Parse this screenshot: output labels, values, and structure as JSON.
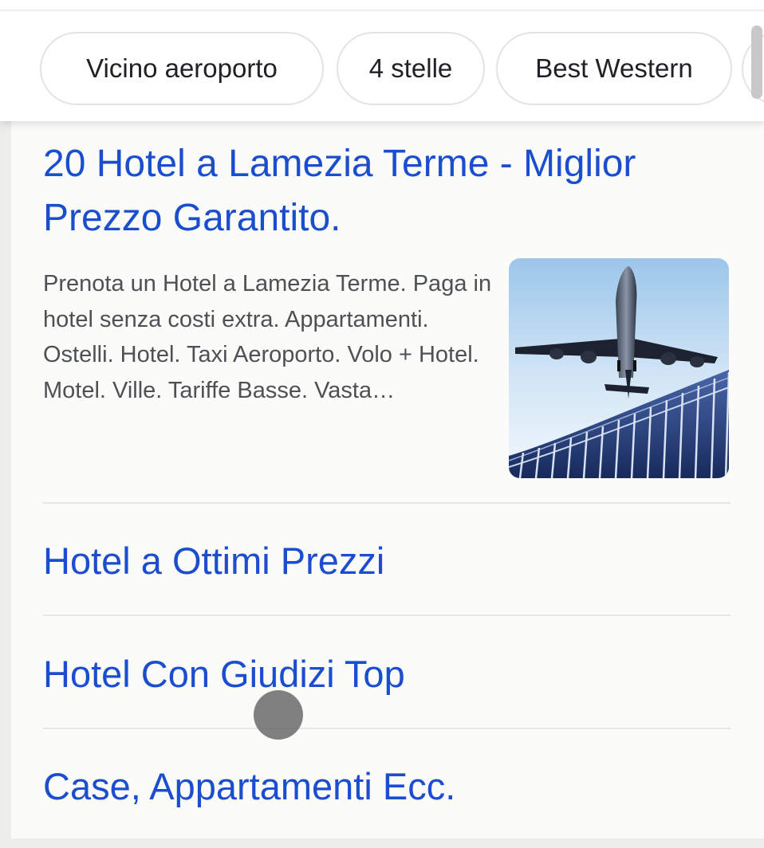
{
  "filter_chips": [
    "Vicino aeroporto",
    "4 stelle",
    "Best Western"
  ],
  "result": {
    "title": "20 Hotel a Lamezia Terme - Miglior Prezzo Garantito.",
    "description": "Prenota un Hotel a Lamezia Terme. Paga in hotel senza costi extra. Appartamenti. Ostelli. Hotel. Taxi Aeroporto. Volo + Hotel. Motel. Ville. Tariffe Basse. Vasta…",
    "thumbnail_icon": "airplane-over-terminal-image",
    "sitelinks": [
      "Hotel a Ottimi Prezzi",
      "Hotel Con Giudizi Top",
      "Case, Appartamenti Ecc."
    ]
  },
  "colors": {
    "link": "#1a4ecf",
    "description_text": "#4d5156",
    "chip_text": "#202124",
    "background": "#fbfbf9"
  }
}
